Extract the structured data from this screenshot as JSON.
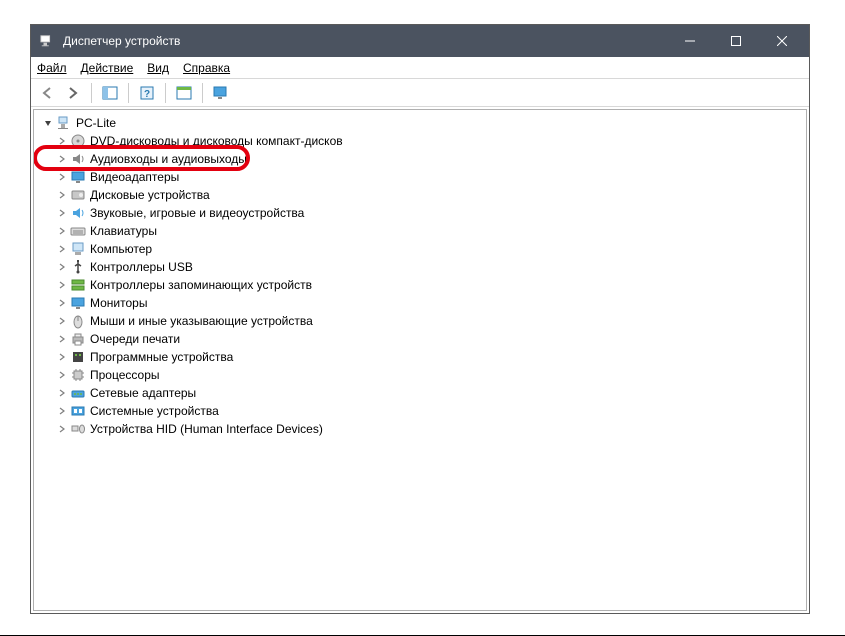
{
  "window": {
    "title": "Диспетчер устройств"
  },
  "menu": {
    "file": "Файл",
    "action": "Действие",
    "view": "Вид",
    "help": "Справка"
  },
  "tree": {
    "root": "PC-Lite",
    "items": [
      {
        "label": "DVD-дисководы и дисководы компакт-дисков",
        "icon": "dvd"
      },
      {
        "label": "Аудиовходы и аудиовыходы",
        "icon": "audio",
        "highlight": true
      },
      {
        "label": "Видеоадаптеры",
        "icon": "display"
      },
      {
        "label": "Дисковые устройства",
        "icon": "disk"
      },
      {
        "label": "Звуковые, игровые и видеоустройства",
        "icon": "sound"
      },
      {
        "label": "Клавиатуры",
        "icon": "keyboard"
      },
      {
        "label": "Компьютер",
        "icon": "computer"
      },
      {
        "label": "Контроллеры USB",
        "icon": "usb"
      },
      {
        "label": "Контроллеры запоминающих устройств",
        "icon": "storage"
      },
      {
        "label": "Мониторы",
        "icon": "monitor"
      },
      {
        "label": "Мыши и иные указывающие устройства",
        "icon": "mouse"
      },
      {
        "label": "Очереди печати",
        "icon": "printer"
      },
      {
        "label": "Программные устройства",
        "icon": "software"
      },
      {
        "label": "Процессоры",
        "icon": "cpu"
      },
      {
        "label": "Сетевые адаптеры",
        "icon": "network"
      },
      {
        "label": "Системные устройства",
        "icon": "system"
      },
      {
        "label": "Устройства HID (Human Interface Devices)",
        "icon": "hid"
      }
    ]
  }
}
